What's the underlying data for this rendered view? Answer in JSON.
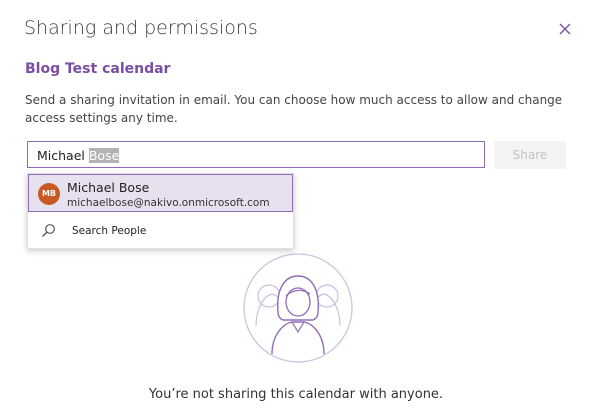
{
  "dialog": {
    "title": "Sharing and permissions",
    "close_icon": "close-icon",
    "calendar_name": "Blog Test calendar",
    "description": "Send a sharing invitation in email. You can choose how much access to allow and change access settings any time."
  },
  "invite": {
    "typed_text": "Michael ",
    "autocomplete_text": "Bose",
    "share_label": "Share"
  },
  "suggestions": {
    "person": {
      "initials": "MB",
      "name": "Michael Bose",
      "email": "michaelbose@nakivo.onmicrosoft.com",
      "avatar_color": "#c75a24"
    },
    "search_label": "Search People",
    "search_icon": "search-icon"
  },
  "empty_state": {
    "illustration": "people-group-icon",
    "message": "You’re not sharing this calendar with anyone."
  },
  "colors": {
    "accent": "#7a4ea3",
    "input_border": "#8f6bb7",
    "selection_bg": "#e7e0ef"
  }
}
